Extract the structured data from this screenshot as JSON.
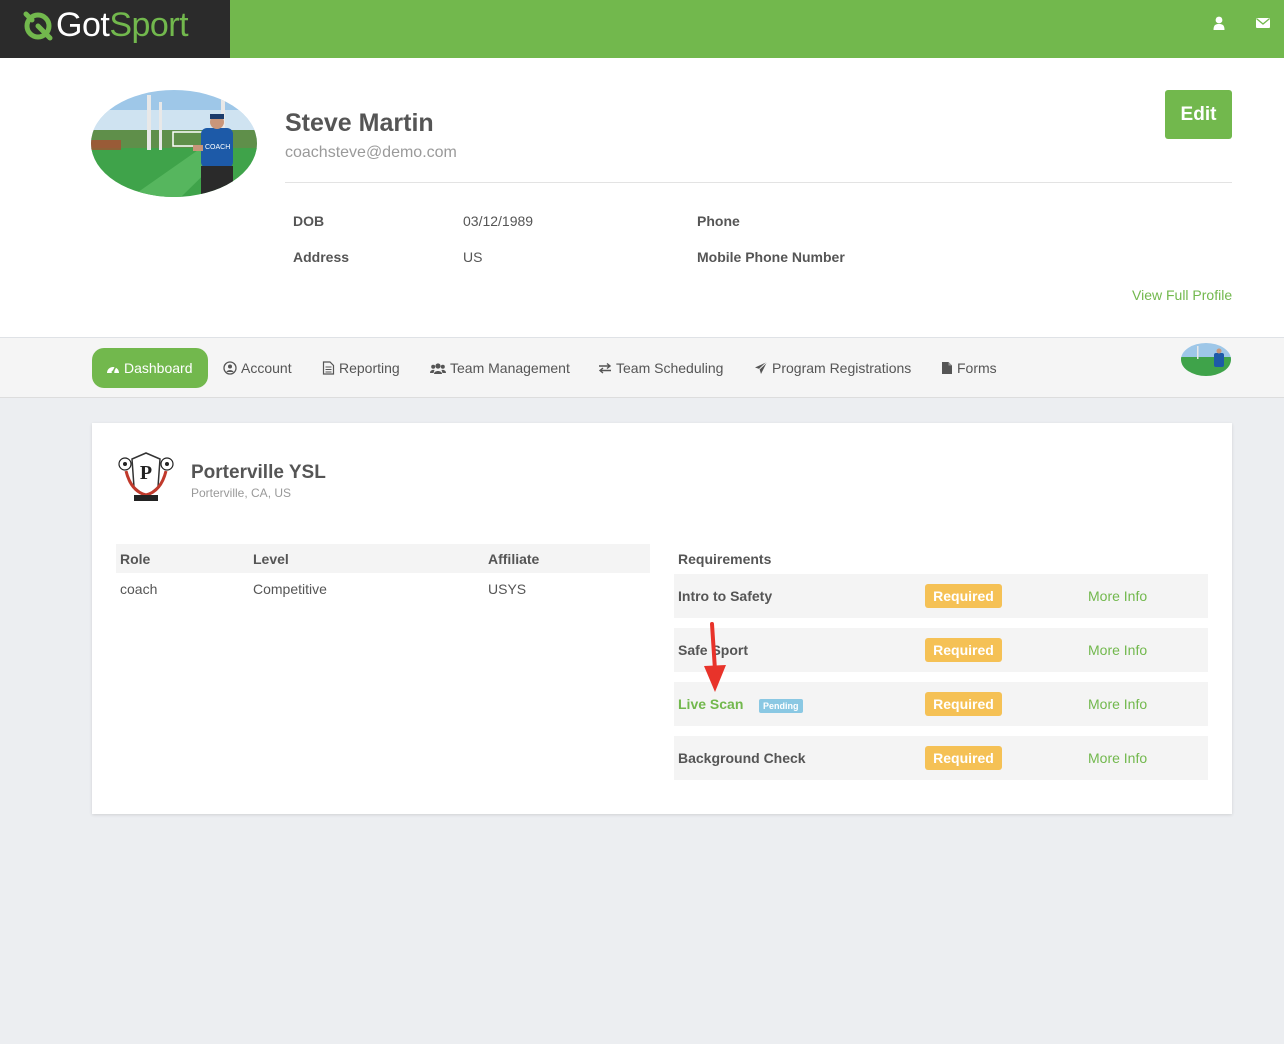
{
  "brand": {
    "logo_got": "Got",
    "logo_sport": "Sport",
    "green": "#72b84d",
    "dark": "#2b2b2b"
  },
  "topbar": {
    "icons": [
      "user-icon",
      "envelope-icon"
    ]
  },
  "profile": {
    "name": "Steve Martin",
    "email": "coachsteve@demo.com",
    "edit_label": "Edit",
    "fields": {
      "dob_label": "DOB",
      "dob_value": "03/12/1989",
      "address_label": "Address",
      "address_value": "US",
      "phone_label": "Phone",
      "mobile_label": "Mobile Phone Number"
    },
    "view_full_profile": "View Full Profile"
  },
  "nav": {
    "items": [
      {
        "label": "Dashboard",
        "icon": "dashboard-icon",
        "active": true
      },
      {
        "label": "Account",
        "icon": "user-circle-icon"
      },
      {
        "label": "Reporting",
        "icon": "file-text-icon"
      },
      {
        "label": "Team Management",
        "icon": "users-icon"
      },
      {
        "label": "Team Scheduling",
        "icon": "exchange-icon"
      },
      {
        "label": "Program Registrations",
        "icon": "paper-plane-icon"
      },
      {
        "label": "Forms",
        "icon": "file-icon"
      }
    ]
  },
  "club": {
    "name": "Porterville YSL",
    "location": "Porterville, CA, US",
    "roles_table": {
      "headers": [
        "Role",
        "Level",
        "Affiliate"
      ],
      "rows": [
        [
          "coach",
          "Competitive",
          "USYS"
        ]
      ]
    },
    "requirements": {
      "title": "Requirements",
      "items": [
        {
          "name": "Intro to Safety",
          "status": "Required",
          "link": "More Info"
        },
        {
          "name": "Safe Sport",
          "status": "Required",
          "link": "More Info"
        },
        {
          "name": "Live Scan",
          "badge": "Pending",
          "status": "Required",
          "link": "More Info"
        },
        {
          "name": "Background Check",
          "status": "Required",
          "link": "More Info"
        }
      ]
    }
  }
}
